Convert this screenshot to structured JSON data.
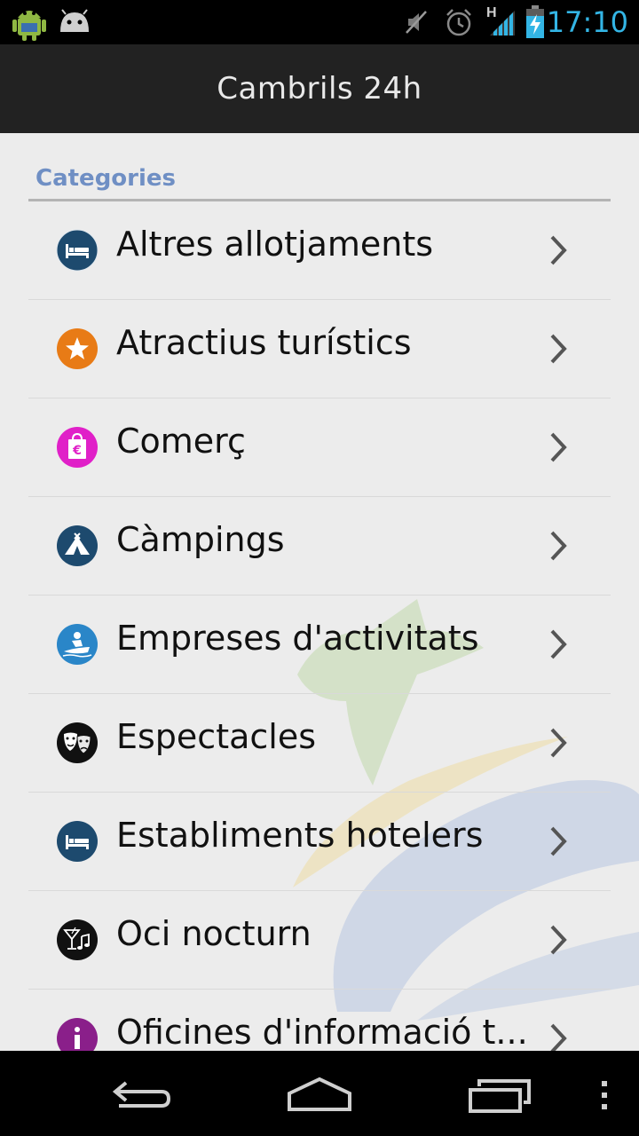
{
  "status_bar": {
    "time": "17:10",
    "network_label": "H",
    "icons": [
      "android-debug-icon",
      "android-notification-icon",
      "mute-icon",
      "alarm-icon",
      "signal-icon",
      "battery-charging-icon"
    ]
  },
  "action_bar": {
    "title": "Cambrils 24h"
  },
  "section": {
    "title": "Categories"
  },
  "categories": [
    {
      "label": "Altres allotjaments",
      "icon": "bed-icon",
      "color": "#1d4a6e"
    },
    {
      "label": "Atractius turístics",
      "icon": "star-icon",
      "color": "#e87b16"
    },
    {
      "label": "Comerç",
      "icon": "shopping-bag-icon",
      "color": "#e020c8"
    },
    {
      "label": "Càmpings",
      "icon": "tent-icon",
      "color": "#1d4a6e"
    },
    {
      "label": "Empreses d'activitats",
      "icon": "jetski-icon",
      "color": "#2a86c8"
    },
    {
      "label": "Espectacles",
      "icon": "theater-masks-icon",
      "color": "#111111"
    },
    {
      "label": "Establiments hotelers",
      "icon": "bed-icon",
      "color": "#1d4a6e"
    },
    {
      "label": "Oci nocturn",
      "icon": "cocktail-icon",
      "color": "#111111"
    },
    {
      "label": "Oficines d'informació t...",
      "icon": "info-icon",
      "color": "#8a1f8a"
    }
  ],
  "nav_bar": {
    "buttons": [
      "back-icon",
      "home-icon",
      "recents-icon",
      "overflow-menu-icon"
    ]
  }
}
